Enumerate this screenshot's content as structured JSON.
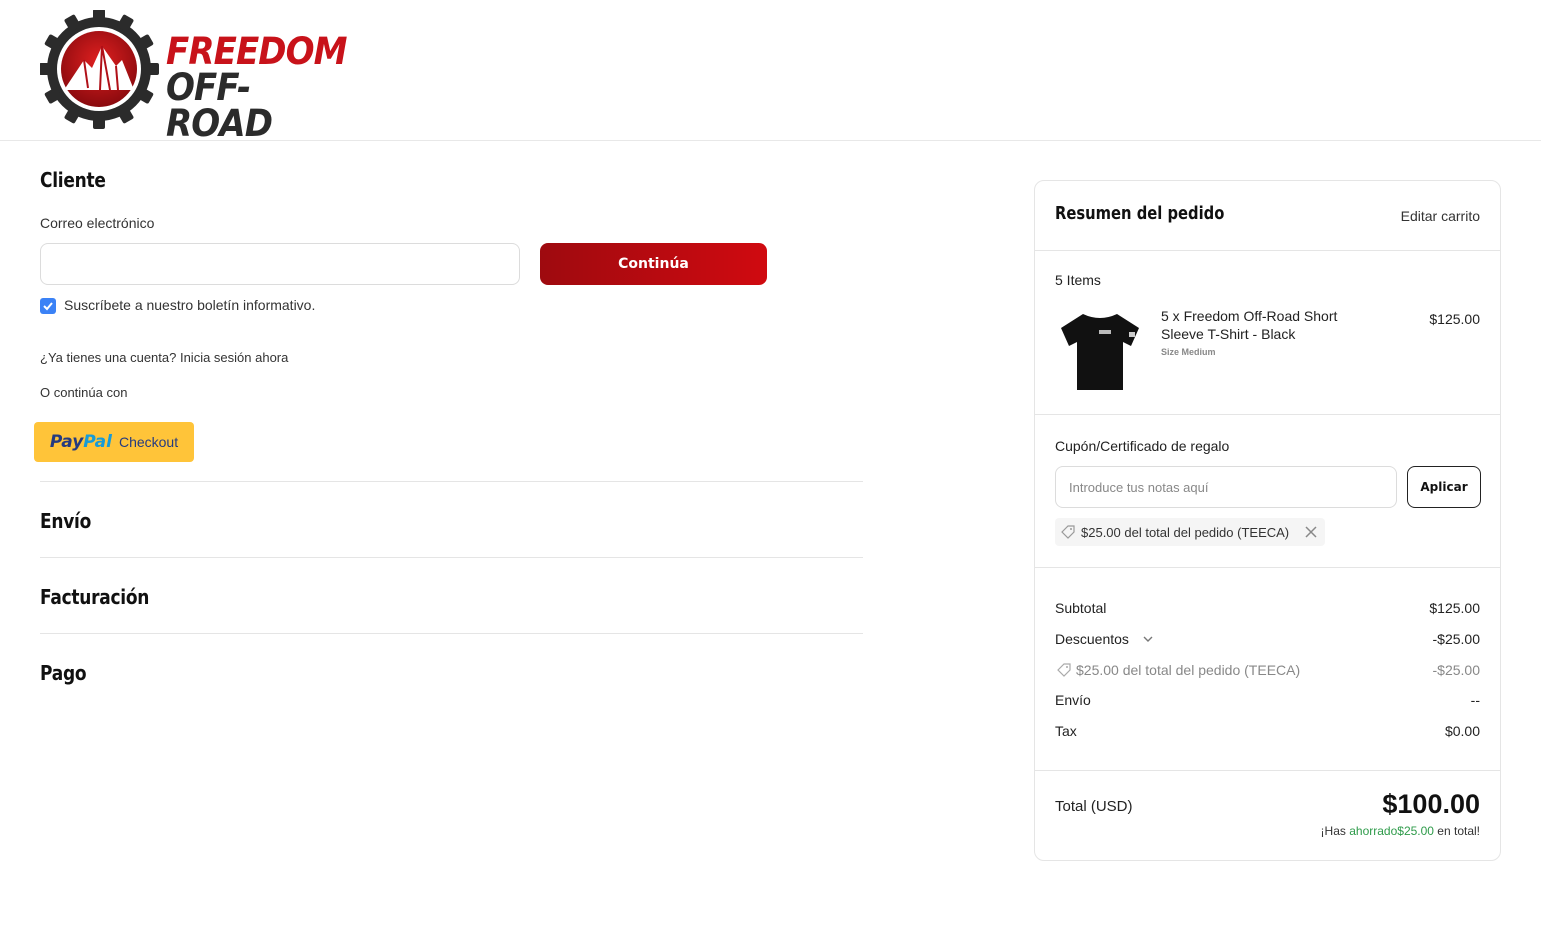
{
  "brand": {
    "line1": "FREEDOM",
    "line2": "OFF-ROAD"
  },
  "customer": {
    "title": "Cliente",
    "email_label": "Correo electrónico",
    "email_value": "",
    "continue_label": "Continúa",
    "newsletter_label": "Suscríbete a nuestro boletín informativo.",
    "newsletter_checked": true,
    "login_prompt": "¿Ya tienes una cuenta? Inicia sesión ahora",
    "or_continue": "O continúa con",
    "paypal": {
      "pay": "Pay",
      "pal": "Pal",
      "checkout": "Checkout"
    }
  },
  "sections": {
    "shipping": "Envío",
    "billing": "Facturación",
    "payment": "Pago"
  },
  "summary": {
    "title": "Resumen del pedido",
    "edit_cart": "Editar carrito",
    "items_count": "5 Items",
    "item": {
      "name_line1": "5 x Freedom Off-Road Short",
      "name_line2": "Sleeve T-Shirt - Black",
      "size": "Size Medium",
      "price": "$125.00"
    },
    "coupon": {
      "label": "Cupón/Certificado de regalo",
      "placeholder": "Introduce tus notas aquí",
      "apply_label": "Aplicar",
      "applied": "$25.00 del total del pedido (TEECA)"
    },
    "totals": {
      "subtotal_label": "Subtotal",
      "subtotal": "$125.00",
      "discounts_label": "Descuentos",
      "discounts": "-$25.00",
      "discount_detail_label": "$25.00 del total del pedido (TEECA)",
      "discount_detail": "-$25.00",
      "shipping_label": "Envío",
      "shipping": "--",
      "tax_label": "Tax",
      "tax": "$0.00"
    },
    "total": {
      "label": "Total (USD)",
      "value": "$100.00",
      "saved_prefix": "¡Has ",
      "saved_word": "ahorrado",
      "saved_amount": "$25.00",
      "saved_suffix": " en total!"
    }
  },
  "colors": {
    "brand_red": "#c8121a",
    "checkbox_blue": "#3b82f6",
    "paypal_yellow": "#ffc439",
    "saved_green": "#2e9b4a"
  }
}
